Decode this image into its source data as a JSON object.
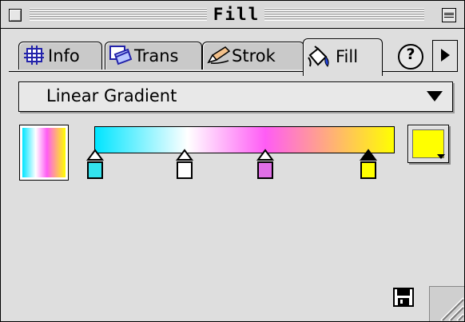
{
  "window": {
    "title": "Fill"
  },
  "tabs": [
    {
      "label": "Info",
      "icon": "info-grid-icon",
      "active": false
    },
    {
      "label": "Trans",
      "icon": "transform-icon",
      "active": false
    },
    {
      "label": "Strok",
      "icon": "pencil-stroke-icon",
      "active": false
    },
    {
      "label": "Fill",
      "icon": "paint-bucket-icon",
      "active": true
    }
  ],
  "help": {
    "label": "?"
  },
  "fill": {
    "type_label": "Linear Gradient",
    "gradient_stops": [
      {
        "color": "#00e5ff",
        "position": 0.0
      },
      {
        "color": "#ffffff",
        "position": 0.31
      },
      {
        "color": "#ff5cf5",
        "position": 0.57
      },
      {
        "color": "#ffff00",
        "position": 1.0
      }
    ],
    "markers": [
      {
        "color": "#33e3ee",
        "selected": false
      },
      {
        "color": "#ffffff",
        "selected": false
      },
      {
        "color": "#e06fe6",
        "selected": false
      },
      {
        "color": "#ffff00",
        "selected": true
      }
    ],
    "selected_color": "#ffff00"
  },
  "colors": {
    "panel_bg": "#dedede",
    "border": "#000000"
  }
}
